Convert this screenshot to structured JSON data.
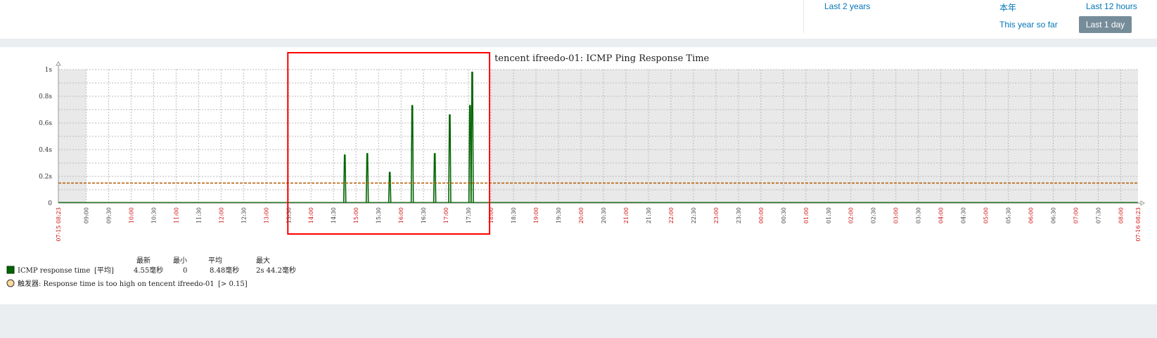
{
  "timeperiods": {
    "last_2_years": "Last 2 years",
    "this_year": "本年",
    "last_12_hours": "Last 12 hours",
    "this_year_so_far": "This year so far",
    "last_1_day": "Last 1 day"
  },
  "colors": {
    "series": "#006400",
    "trigger": "#b35900",
    "highlight": "#ff0000",
    "time_label": "#cc0000"
  },
  "chart_data": {
    "type": "line",
    "title": "tencent ifreedo-01: ICMP Ping Response Time",
    "y_ticks": [
      "0",
      "0.2s",
      "0.4s",
      "0.6s",
      "0.8s",
      "1s"
    ],
    "ylim": [
      0,
      1
    ],
    "x_start": "07-15 08:23",
    "x_end": "07-16 08:23",
    "x_labels": [
      "09:00",
      "09:30",
      "10:00",
      "10:30",
      "11:00",
      "11:30",
      "12:00",
      "12:30",
      "13:00",
      "13:30",
      "14:00",
      "14:30",
      "15:00",
      "15:30",
      "16:00",
      "16:30",
      "17:00",
      "17:30",
      "18:00",
      "18:30",
      "19:00",
      "19:30",
      "20:00",
      "20:30",
      "21:00",
      "21:30",
      "22:00",
      "22:30",
      "23:00",
      "23:30",
      "00:00",
      "00:30",
      "01:00",
      "01:30",
      "02:00",
      "02:30",
      "03:00",
      "03:30",
      "04:00",
      "04:30",
      "05:00",
      "05:30",
      "06:00",
      "06:30",
      "07:00",
      "07:30",
      "08:00"
    ],
    "hour_labels_red": [
      "10:00",
      "11:00",
      "12:00",
      "13:00",
      "14:00",
      "15:00",
      "16:00",
      "17:00",
      "18:00",
      "19:00",
      "20:00",
      "21:00",
      "22:00",
      "23:00",
      "00:00",
      "01:00",
      "02:00",
      "03:00",
      "04:00",
      "05:00",
      "06:00",
      "07:00",
      "08:00"
    ],
    "series": [
      {
        "name": "ICMP response time",
        "baseline": 0.005,
        "spikes": [
          {
            "x": "14:45",
            "y": 0.36
          },
          {
            "x": "15:15",
            "y": 0.37
          },
          {
            "x": "15:45",
            "y": 0.23
          },
          {
            "x": "16:15",
            "y": 0.73
          },
          {
            "x": "16:45",
            "y": 0.37
          },
          {
            "x": "17:05",
            "y": 0.66
          },
          {
            "x": "17:35",
            "y": 0.98
          },
          {
            "x": "17:32",
            "y": 0.73
          }
        ]
      }
    ],
    "trigger_line": 0.15,
    "highlight_range": [
      "13:30",
      "18:00"
    ],
    "legend": {
      "headers": [
        "最新",
        "最小",
        "平均",
        "最大"
      ],
      "item": {
        "name": "ICMP response time",
        "func": "[平均]",
        "last": "4.55毫秒",
        "min": "0",
        "avg": "8.48毫秒",
        "max": "2s 44.2毫秒"
      },
      "trigger": {
        "label": "触发器: Response time is too high on tencent ifreedo-01",
        "condition": "[> 0.15]"
      }
    }
  }
}
